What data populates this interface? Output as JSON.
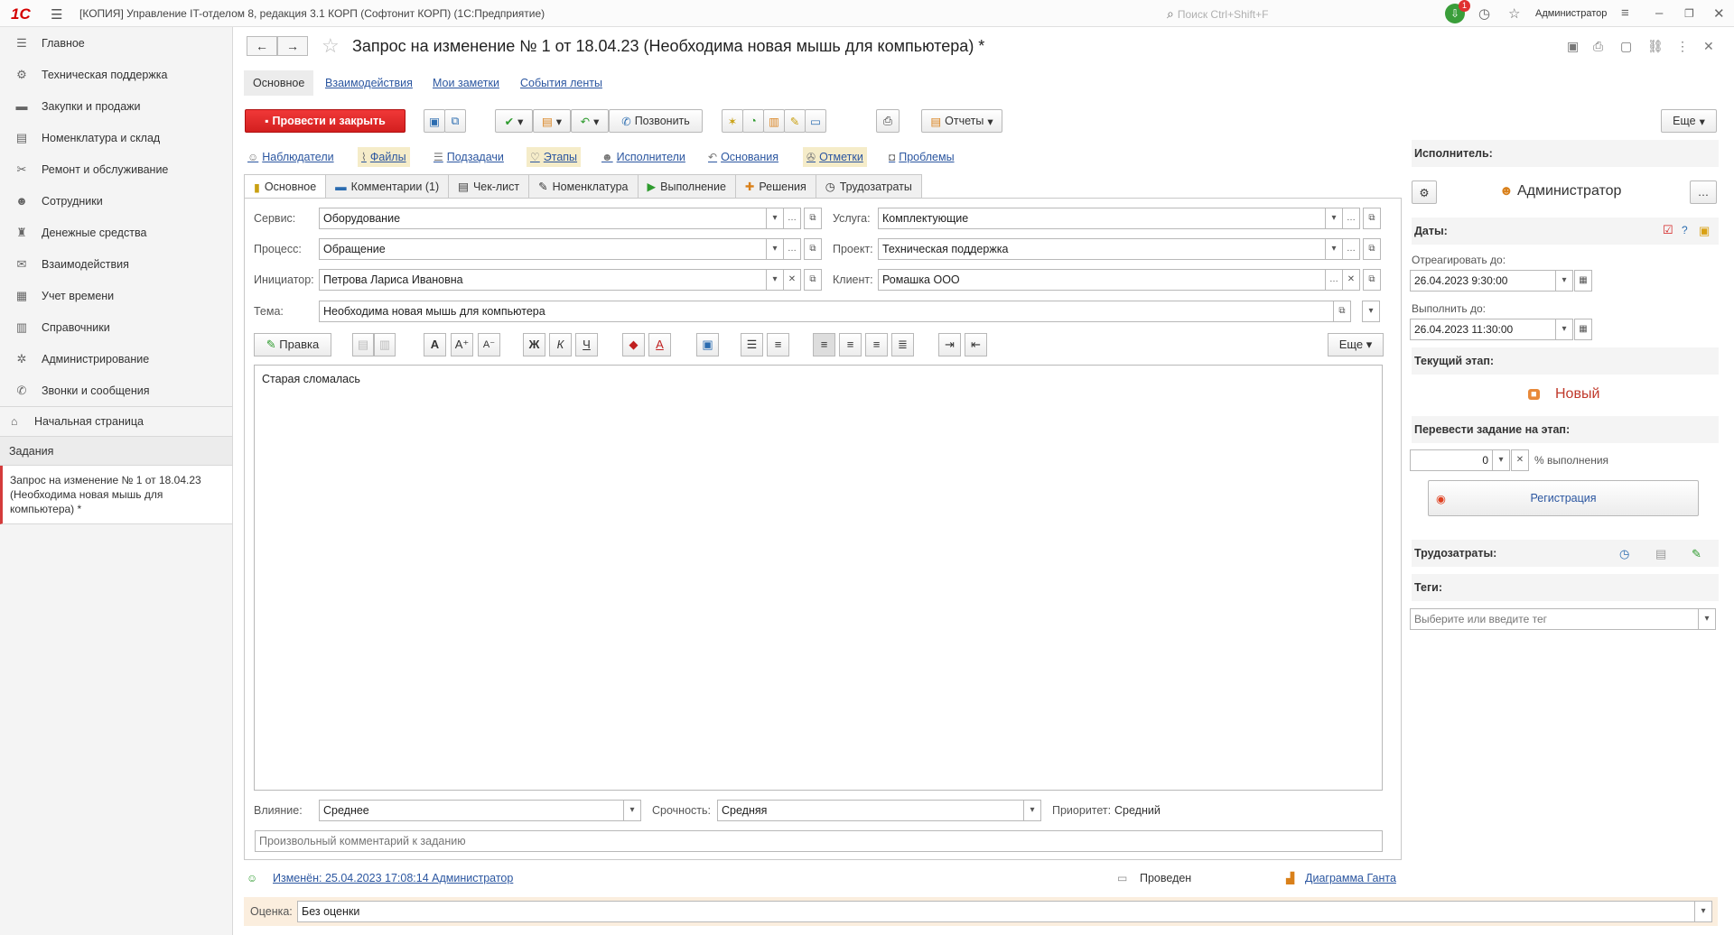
{
  "titlebar": {
    "logo": "1С",
    "title": "[КОПИЯ] Управление IT-отделом 8, редакция 3.1 КОРП (Софтонит КОРП)  (1С:Предприятие)",
    "search_placeholder": "Поиск Ctrl+Shift+F",
    "notif_count": "1",
    "user": "Администратор"
  },
  "sidebar": {
    "items": [
      {
        "label": "Главное",
        "icon": "menu-icon"
      },
      {
        "label": "Техническая поддержка",
        "icon": "support-icon"
      },
      {
        "label": "Закупки и продажи",
        "icon": "truck-icon"
      },
      {
        "label": "Номенклатура и склад",
        "icon": "warehouse-icon"
      },
      {
        "label": "Ремонт и обслуживание",
        "icon": "repair-icon"
      },
      {
        "label": "Сотрудники",
        "icon": "people-icon"
      },
      {
        "label": "Денежные средства",
        "icon": "money-icon"
      },
      {
        "label": "Взаимодействия",
        "icon": "mail-icon"
      },
      {
        "label": "Учет времени",
        "icon": "calendar-icon"
      },
      {
        "label": "Справочники",
        "icon": "books-icon"
      },
      {
        "label": "Администрирование",
        "icon": "gear-icon"
      },
      {
        "label": "Звонки и сообщения",
        "icon": "phone-icon"
      }
    ],
    "home": "Начальная страница",
    "tasks": "Задания",
    "open_doc": "Запрос на изменение № 1 от 18.04.23 (Необходима новая мышь для компьютера) *"
  },
  "doc": {
    "title": "Запрос на изменение № 1 от 18.04.23 (Необходима новая мышь для компьютера) *",
    "subtabs": [
      "Основное",
      "Взаимодействия",
      "Мои заметки",
      "События ленты"
    ]
  },
  "toolbar": {
    "post_close": "Провести и закрыть",
    "call": "Позвонить",
    "reports": "Отчеты",
    "more": "Еще"
  },
  "links": [
    "Наблюдатели",
    "Файлы",
    "Подзадачи",
    "Этапы",
    "Исполнители",
    "Основания",
    "Отметки",
    "Проблемы"
  ],
  "tabs": [
    "Основное",
    "Комментарии (1)",
    "Чек-лист",
    "Номенклатура",
    "Выполнение",
    "Решения",
    "Трудозатраты"
  ],
  "form": {
    "service_label": "Сервис:",
    "service": "Оборудование",
    "process_label": "Процесс:",
    "process": "Обращение",
    "initiator_label": "Инициатор:",
    "initiator": "Петрова Лариса Ивановна",
    "usluga_label": "Услуга:",
    "usluga": "Комплектующие",
    "project_label": "Проект:",
    "project": "Техническая поддержка",
    "client_label": "Клиент:",
    "client": "Ромашка ООО",
    "topic_label": "Тема:",
    "topic": "Необходима новая мышь для компьютера",
    "edit_btn": "Правка",
    "more_btn": "Еще",
    "body": "Старая сломалась",
    "impact_label": "Влияние:",
    "impact": "Среднее",
    "urgency_label": "Срочность:",
    "urgency": "Средняя",
    "priority_label": "Приоритет:",
    "priority": "Средний",
    "comment_placeholder": "Произвольный комментарий к заданию"
  },
  "fmt": {
    "bold": "Ж",
    "italic": "К",
    "underline": "Ч"
  },
  "right": {
    "executor_label": "Исполнитель:",
    "executor": "Администратор",
    "dates_label": "Даты:",
    "react_label": "Отреагировать до:",
    "react": "26.04.2023  9:30:00",
    "done_label": "Выполнить до:",
    "done": "26.04.2023 11:30:00",
    "stage_label": "Текущий этап:",
    "stage": "Новый",
    "move_label": "Перевести задание на этап:",
    "percent": "0",
    "percent_label": "% выполнения",
    "reg_btn": "Регистрация",
    "labor_label": "Трудозатраты:",
    "tags_label": "Теги:",
    "tags_placeholder": "Выберите или введите тег"
  },
  "status": {
    "changed": "Изменён: 25.04.2023 17:08:14 Администратор",
    "posted": "Проведен",
    "gantt": "Диаграмма Ганта"
  },
  "rating": {
    "label": "Оценка:",
    "value": "Без оценки"
  }
}
